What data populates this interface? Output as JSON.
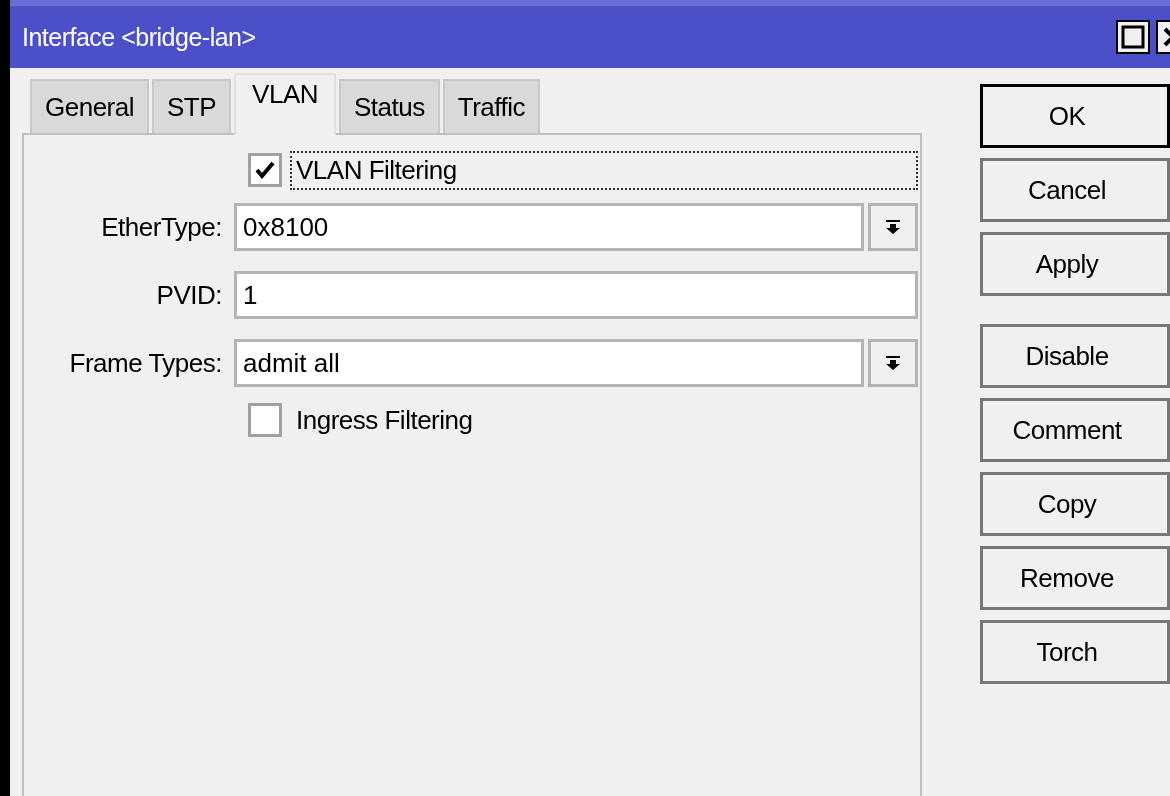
{
  "window": {
    "title": "Interface <bridge-lan>"
  },
  "tabs": [
    {
      "label": "General",
      "selected": false
    },
    {
      "label": "STP",
      "selected": false
    },
    {
      "label": "VLAN",
      "selected": true
    },
    {
      "label": "Status",
      "selected": false
    },
    {
      "label": "Traffic",
      "selected": false
    }
  ],
  "form": [
    {
      "kind": "checkbox",
      "label": "VLAN Filtering",
      "checked": true,
      "focused": true
    },
    {
      "kind": "dropdown",
      "label": "EtherType:",
      "value": "0x8100"
    },
    {
      "kind": "text",
      "label": "PVID:",
      "value": "1"
    },
    {
      "kind": "dropdown",
      "label": "Frame Types:",
      "value": "admit all"
    },
    {
      "kind": "checkbox",
      "label": "Ingress Filtering",
      "checked": false,
      "focused": false
    }
  ],
  "button_groups": [
    [
      {
        "label": "OK",
        "default": true
      },
      {
        "label": "Cancel",
        "default": false
      },
      {
        "label": "Apply",
        "default": false
      }
    ],
    [
      {
        "label": "Disable",
        "default": false
      },
      {
        "label": "Comment",
        "default": false
      },
      {
        "label": "Copy",
        "default": false
      },
      {
        "label": "Remove",
        "default": false
      },
      {
        "label": "Torch",
        "default": false
      }
    ]
  ]
}
